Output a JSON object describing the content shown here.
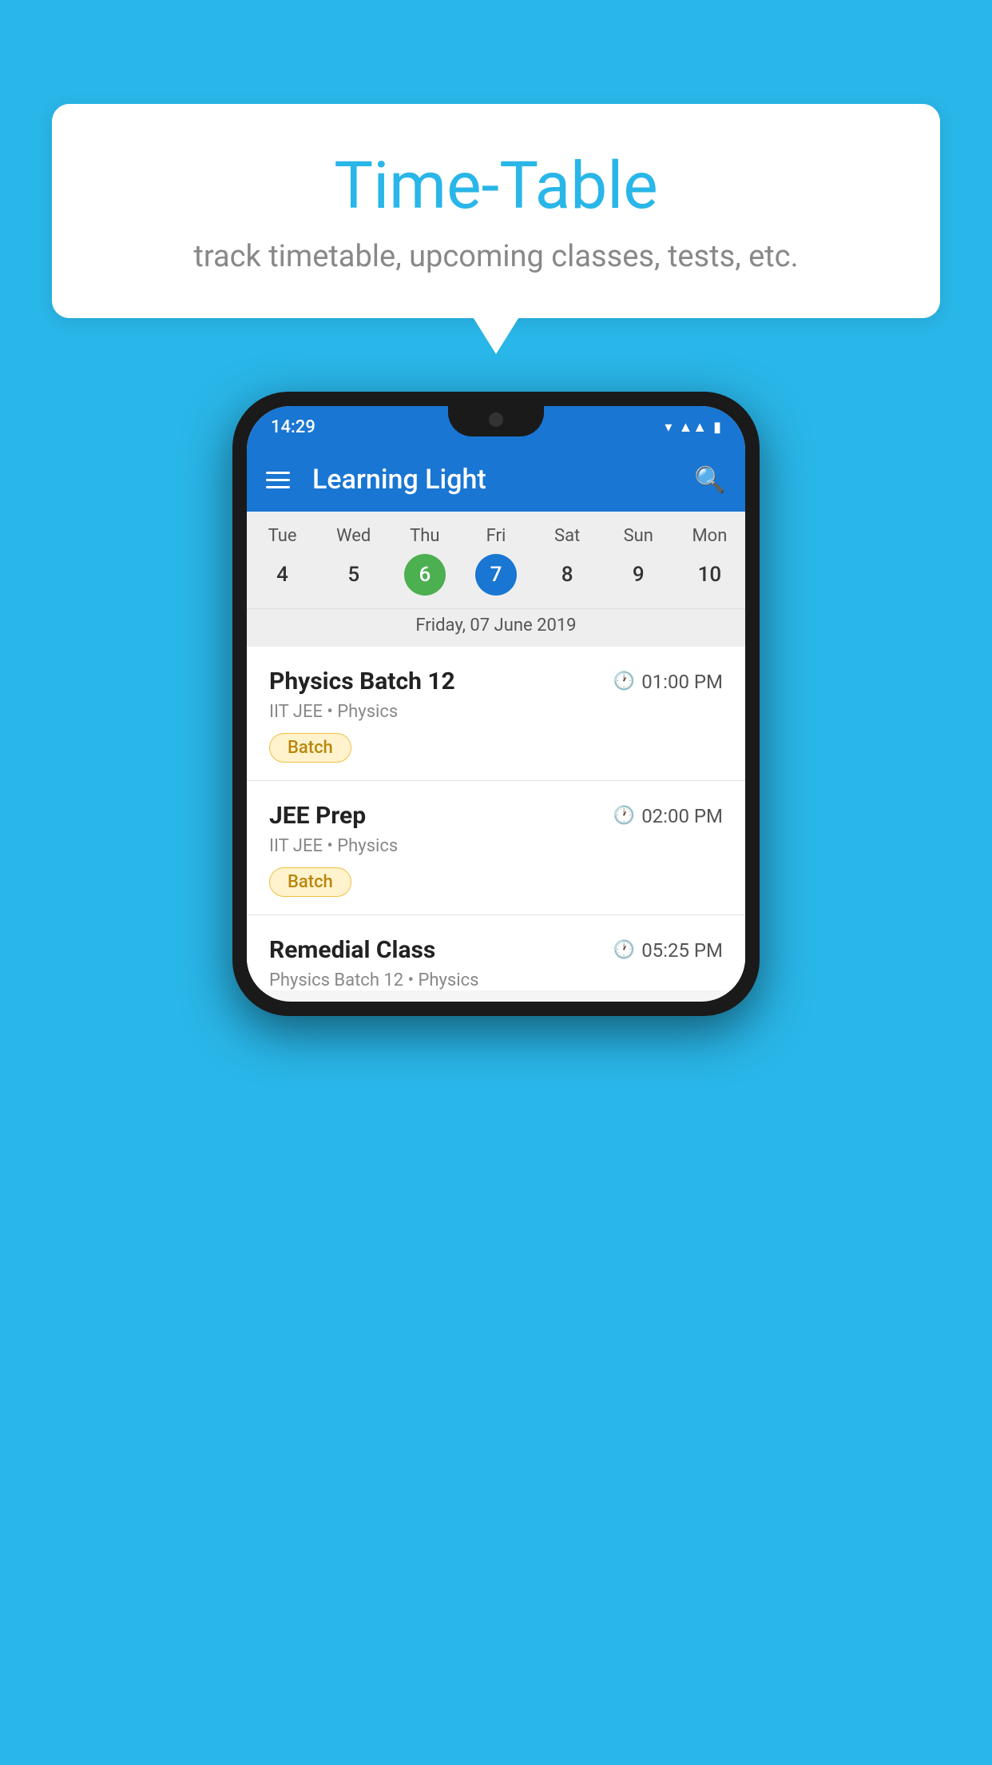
{
  "background_color": "#29B6E8",
  "bubble": {
    "title": "Time-Table",
    "subtitle": "track timetable, upcoming classes, tests, etc."
  },
  "app": {
    "title": "Learning Light"
  },
  "status_bar": {
    "time": "14:29"
  },
  "calendar": {
    "days": [
      {
        "name": "Tue",
        "number": "4",
        "state": "normal"
      },
      {
        "name": "Wed",
        "number": "5",
        "state": "normal"
      },
      {
        "name": "Thu",
        "number": "6",
        "state": "today"
      },
      {
        "name": "Fri",
        "number": "7",
        "state": "selected"
      },
      {
        "name": "Sat",
        "number": "8",
        "state": "normal"
      },
      {
        "name": "Sun",
        "number": "9",
        "state": "normal"
      },
      {
        "name": "Mon",
        "number": "10",
        "state": "normal"
      }
    ],
    "selected_date": "Friday, 07 June 2019"
  },
  "schedule": {
    "items": [
      {
        "title": "Physics Batch 12",
        "time": "01:00 PM",
        "subtitle": "IIT JEE • Physics",
        "badge": "Batch"
      },
      {
        "title": "JEE Prep",
        "time": "02:00 PM",
        "subtitle": "IIT JEE • Physics",
        "badge": "Batch"
      },
      {
        "title": "Remedial Class",
        "time": "05:25 PM",
        "subtitle": "Physics Batch 12 • Physics",
        "badge": ""
      }
    ]
  }
}
